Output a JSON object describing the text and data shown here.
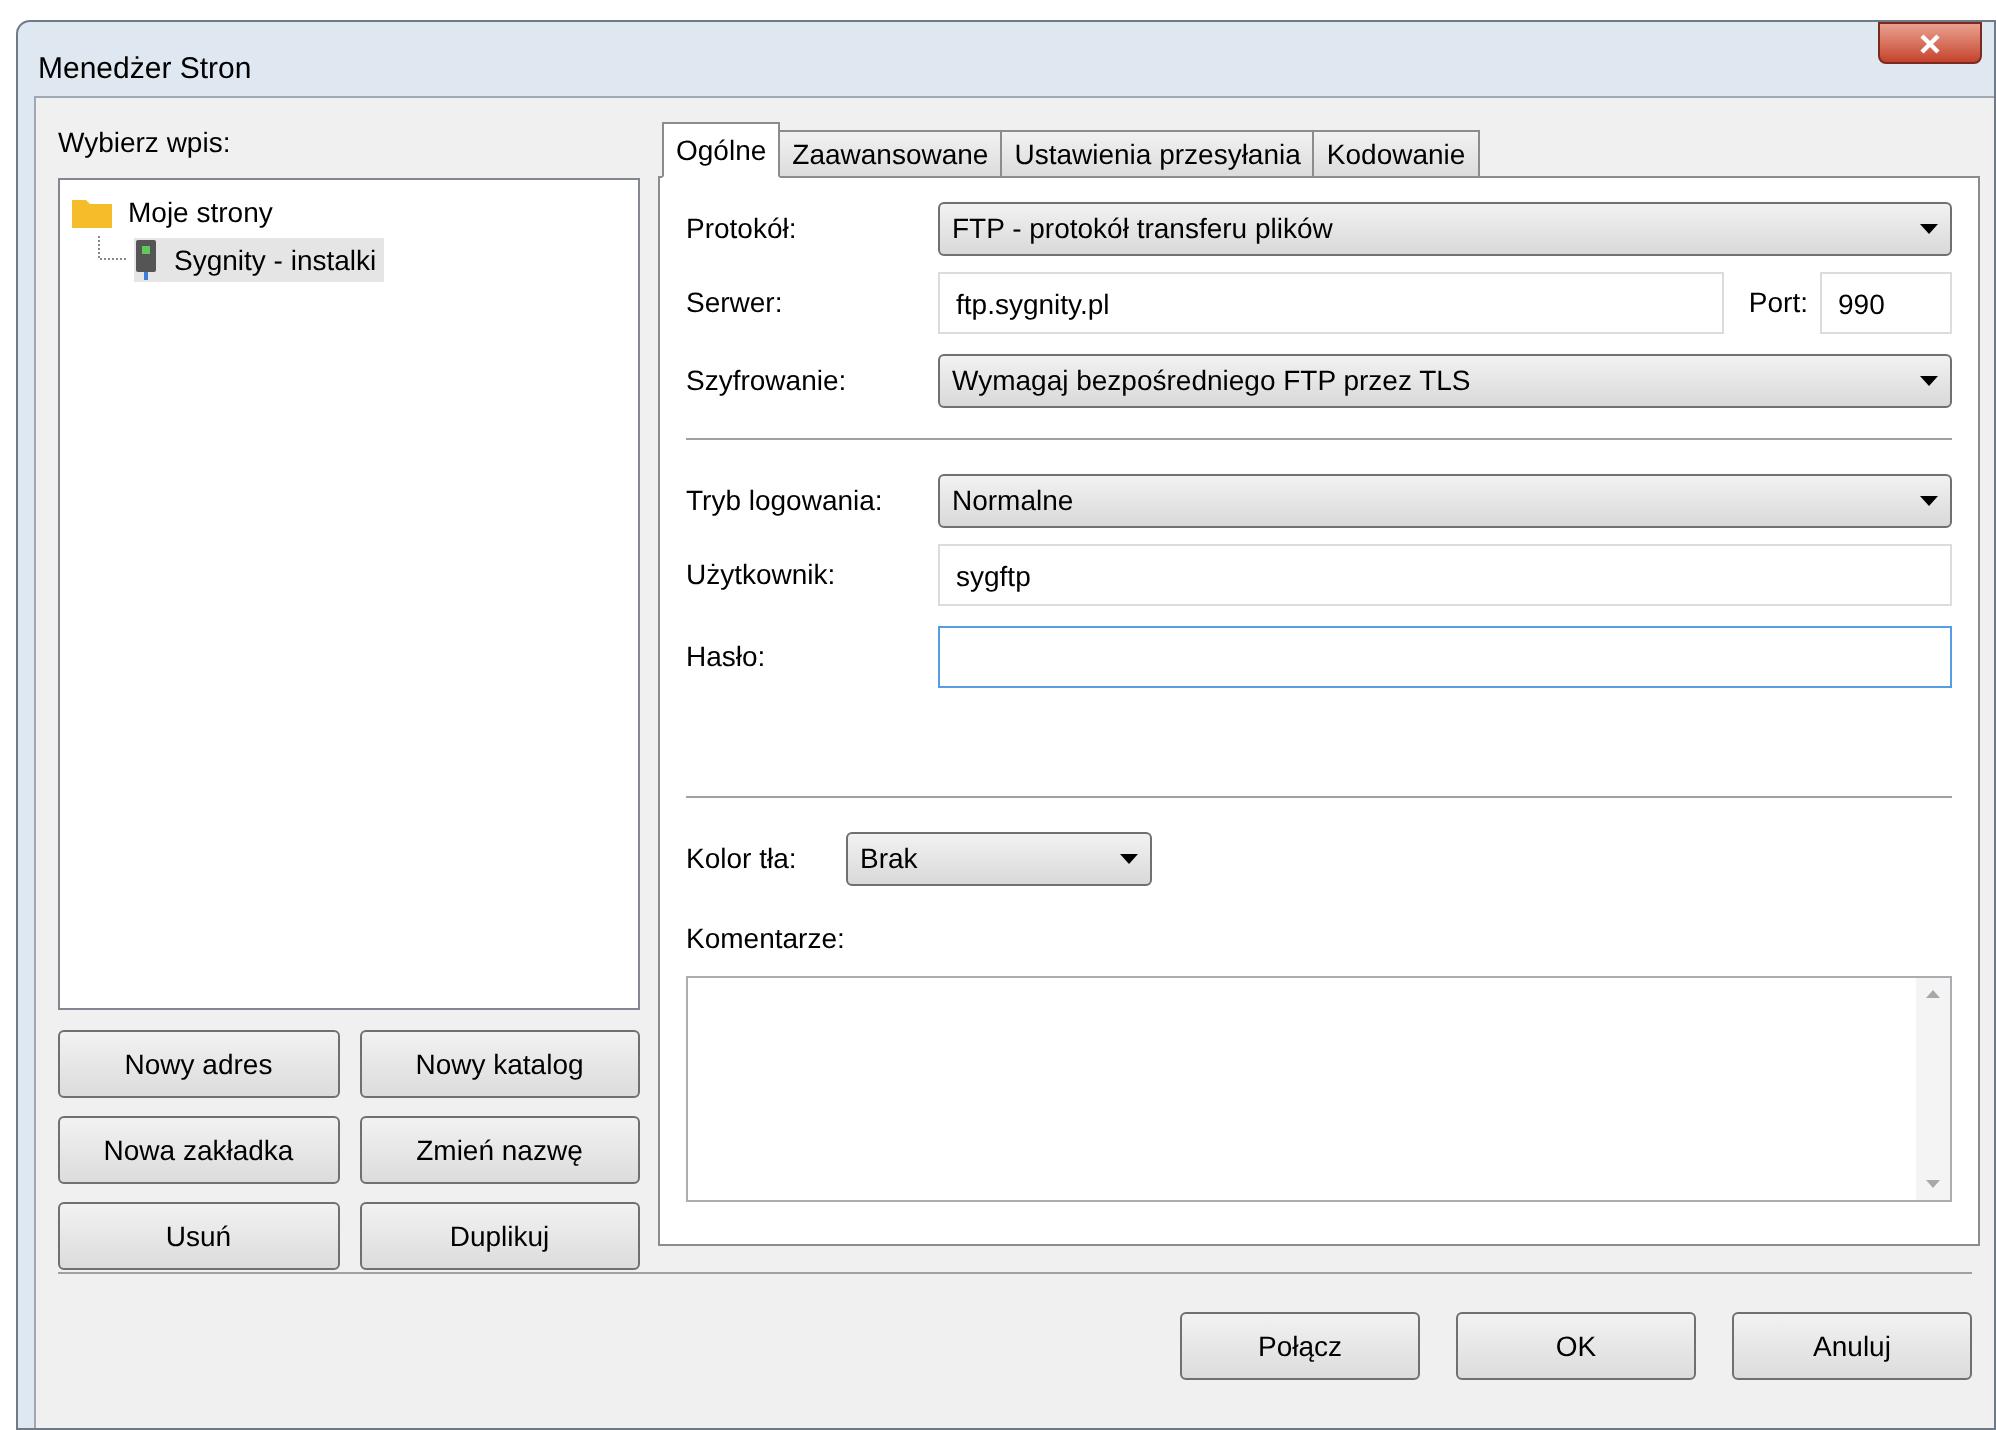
{
  "window": {
    "title": "Menedżer Stron"
  },
  "site_tree": {
    "label": "Wybierz wpis:",
    "items": [
      {
        "label": "Moje strony",
        "kind": "folder",
        "selected": false,
        "children": [
          {
            "label": "Sygnity - instalki",
            "kind": "server",
            "selected": true
          }
        ]
      }
    ]
  },
  "tree_buttons": [
    "Nowy adres",
    "Nowy katalog",
    "Nowa zakładka",
    "Zmień nazwę",
    "Usuń",
    "Duplikuj"
  ],
  "tabs": [
    {
      "label": "Ogólne",
      "selected": true
    },
    {
      "label": "Zaawansowane",
      "selected": false
    },
    {
      "label": "Ustawienia przesyłania",
      "selected": false
    },
    {
      "label": "Kodowanie",
      "selected": false
    }
  ],
  "general": {
    "protocol": {
      "label": "Protokół:",
      "value": "FTP - protokół transferu plików"
    },
    "server": {
      "label": "Serwer:",
      "value": "ftp.sygnity.pl"
    },
    "port": {
      "label": "Port:",
      "value": "990"
    },
    "encryption": {
      "label": "Szyfrowanie:",
      "value": "Wymagaj bezpośredniego FTP przez TLS"
    },
    "logon_type": {
      "label": "Tryb logowania:",
      "value": "Normalne"
    },
    "user": {
      "label": "Użytkownik:",
      "value": "sygftp"
    },
    "password": {
      "label": "Hasło:",
      "focused": true
    },
    "background_color": {
      "label": "Kolor tła:",
      "value": "Brak"
    },
    "comments": {
      "label": "Komentarze:"
    }
  },
  "buttons": [
    "Połącz",
    "OK",
    "Anuluj"
  ]
}
